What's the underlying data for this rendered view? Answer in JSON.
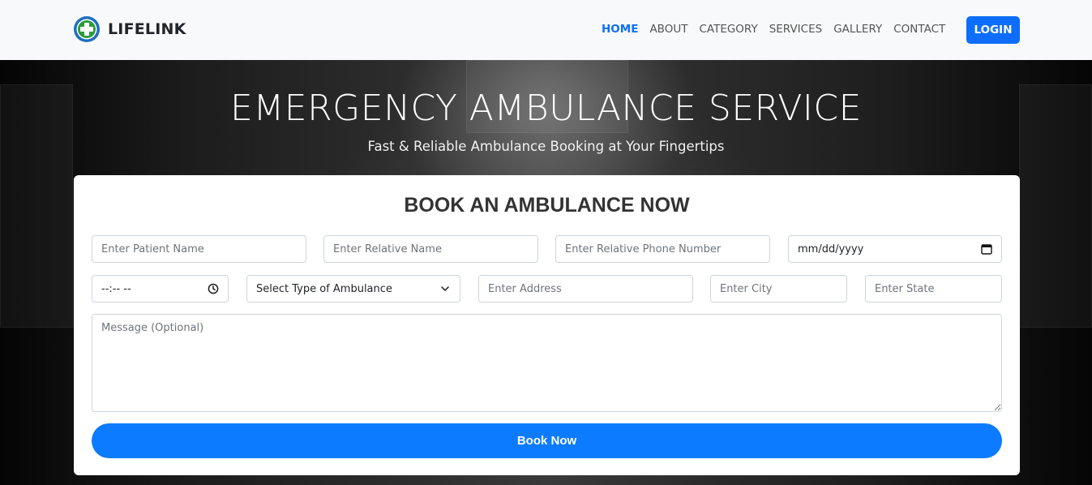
{
  "brand": {
    "name": "LIFELINK",
    "logo_icon": "medical-cross-icon",
    "accent": "#0d6efd"
  },
  "nav": {
    "items": [
      {
        "label": "HOME",
        "active": true
      },
      {
        "label": "ABOUT",
        "active": false
      },
      {
        "label": "CATEGORY",
        "active": false
      },
      {
        "label": "SERVICES",
        "active": false
      },
      {
        "label": "GALLERY",
        "active": false
      },
      {
        "label": "CONTACT",
        "active": false
      }
    ],
    "login_label": "LOGIN"
  },
  "hero": {
    "title": "EMERGENCY AMBULANCE SERVICE",
    "subtitle": "Fast & Reliable Ambulance Booking at Your Fingertips"
  },
  "form": {
    "title": "BOOK AN AMBULANCE NOW",
    "patient_name": {
      "placeholder": "Enter Patient Name",
      "value": ""
    },
    "relative_name": {
      "placeholder": "Enter Relative Name",
      "value": ""
    },
    "relative_phone": {
      "placeholder": "Enter Relative Phone Number",
      "value": ""
    },
    "date": {
      "display": "mm/dd/yyyy",
      "icon": "calendar-icon"
    },
    "time": {
      "display": "--:-- --",
      "icon": "clock-icon"
    },
    "ambulance_type": {
      "selected": "Select Type of Ambulance",
      "icon": "chevron-down-icon"
    },
    "address": {
      "placeholder": "Enter Address",
      "value": ""
    },
    "city": {
      "placeholder": "Enter City",
      "value": ""
    },
    "state": {
      "placeholder": "Enter State",
      "value": ""
    },
    "message": {
      "placeholder": "Message (Optional)",
      "value": ""
    },
    "submit_label": "Book Now",
    "submit_color": "#0d7bff"
  }
}
